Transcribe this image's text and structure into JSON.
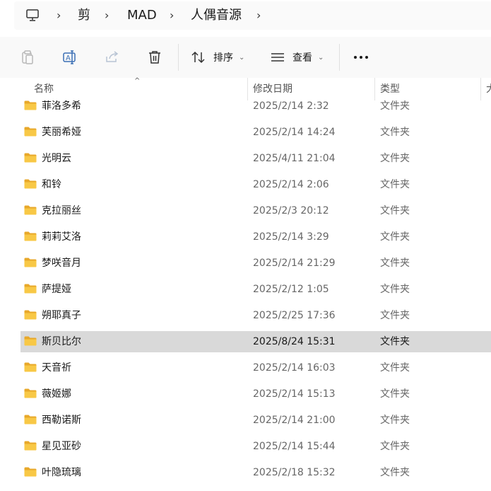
{
  "breadcrumb": {
    "root_icon": "computer-icon",
    "items": [
      "剪",
      "MAD",
      "人偶音源"
    ]
  },
  "toolbar": {
    "copy_icon": "clipboard-icon",
    "rename_icon": "rename-icon",
    "share_icon": "share-icon",
    "delete_icon": "trash-icon",
    "sort_label": "排序",
    "view_label": "查看",
    "more_icon": "more-icon"
  },
  "columns": {
    "name": "名称",
    "date": "修改日期",
    "type": "类型",
    "size": "大"
  },
  "files": [
    {
      "name": "菲洛多希",
      "date": "2025/2/14 2:32",
      "type": "文件夹"
    },
    {
      "name": "芙丽希娅",
      "date": "2025/2/14 14:24",
      "type": "文件夹"
    },
    {
      "name": "光明云",
      "date": "2025/4/11 21:04",
      "type": "文件夹"
    },
    {
      "name": "和铃",
      "date": "2025/2/14 2:06",
      "type": "文件夹"
    },
    {
      "name": "克拉丽丝",
      "date": "2025/2/3 20:12",
      "type": "文件夹"
    },
    {
      "name": "莉莉艾洛",
      "date": "2025/2/14 3:29",
      "type": "文件夹"
    },
    {
      "name": "梦咲音月",
      "date": "2025/2/14 21:29",
      "type": "文件夹"
    },
    {
      "name": "萨提娅",
      "date": "2025/2/12 1:05",
      "type": "文件夹"
    },
    {
      "name": "朔耶真子",
      "date": "2025/2/25 17:36",
      "type": "文件夹"
    },
    {
      "name": "斯贝比尔",
      "date": "2025/8/24 15:31",
      "type": "文件夹",
      "selected": true
    },
    {
      "name": "天音祈",
      "date": "2025/2/14 16:03",
      "type": "文件夹"
    },
    {
      "name": "薇姬娜",
      "date": "2025/2/14 15:13",
      "type": "文件夹"
    },
    {
      "name": "西勒诺斯",
      "date": "2025/2/14 21:00",
      "type": "文件夹"
    },
    {
      "name": "星见亚砂",
      "date": "2025/2/14 15:44",
      "type": "文件夹"
    },
    {
      "name": "叶隐琉璃",
      "date": "2025/2/18 15:32",
      "type": "文件夹"
    }
  ],
  "colors": {
    "selected_row": "#d9d9d9",
    "folder_yellow": "#f8c846",
    "folder_dark": "#e8a82a"
  }
}
